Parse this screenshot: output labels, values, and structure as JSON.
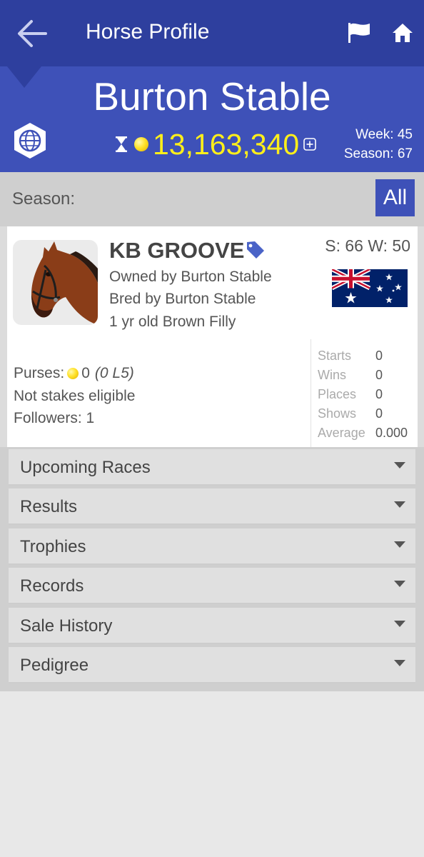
{
  "topbar": {
    "title": "Horse Profile",
    "back_icon": "arrow-left-icon",
    "flag_icon": "flag-icon",
    "home_icon": "home-icon"
  },
  "header": {
    "stable_name": "Burton Stable",
    "money": "13,163,340",
    "week": "Week: 45",
    "season": "Season: 67"
  },
  "season_filter": {
    "label": "Season:",
    "selected": "All"
  },
  "horse": {
    "name": "KB GROOVE",
    "sw": "S: 66 W: 50",
    "owned_by": "Owned by Burton Stable",
    "bred_by": "Bred by Burton Stable",
    "description": "1 yr old Brown Filly",
    "country_flag": "australia-flag",
    "purses_label": "Purses:",
    "purses_value": "0",
    "purses_l5": "(0 L5)",
    "stakes_status": "Not stakes eligible",
    "followers": "Followers: 1"
  },
  "stats": [
    {
      "label": "Starts",
      "value": "0"
    },
    {
      "label": "Wins",
      "value": "0"
    },
    {
      "label": "Places",
      "value": "0"
    },
    {
      "label": "Shows",
      "value": "0"
    },
    {
      "label": "Average",
      "value": "0.000"
    }
  ],
  "sections": [
    {
      "label": "Upcoming Races"
    },
    {
      "label": "Results"
    },
    {
      "label": "Trophies"
    },
    {
      "label": "Records"
    },
    {
      "label": "Sale History"
    },
    {
      "label": "Pedigree"
    }
  ],
  "colors": {
    "topbar": "#2e3f9e",
    "header": "#3e51b8",
    "money": "#ffef1a",
    "accent": "#3e51b8"
  }
}
